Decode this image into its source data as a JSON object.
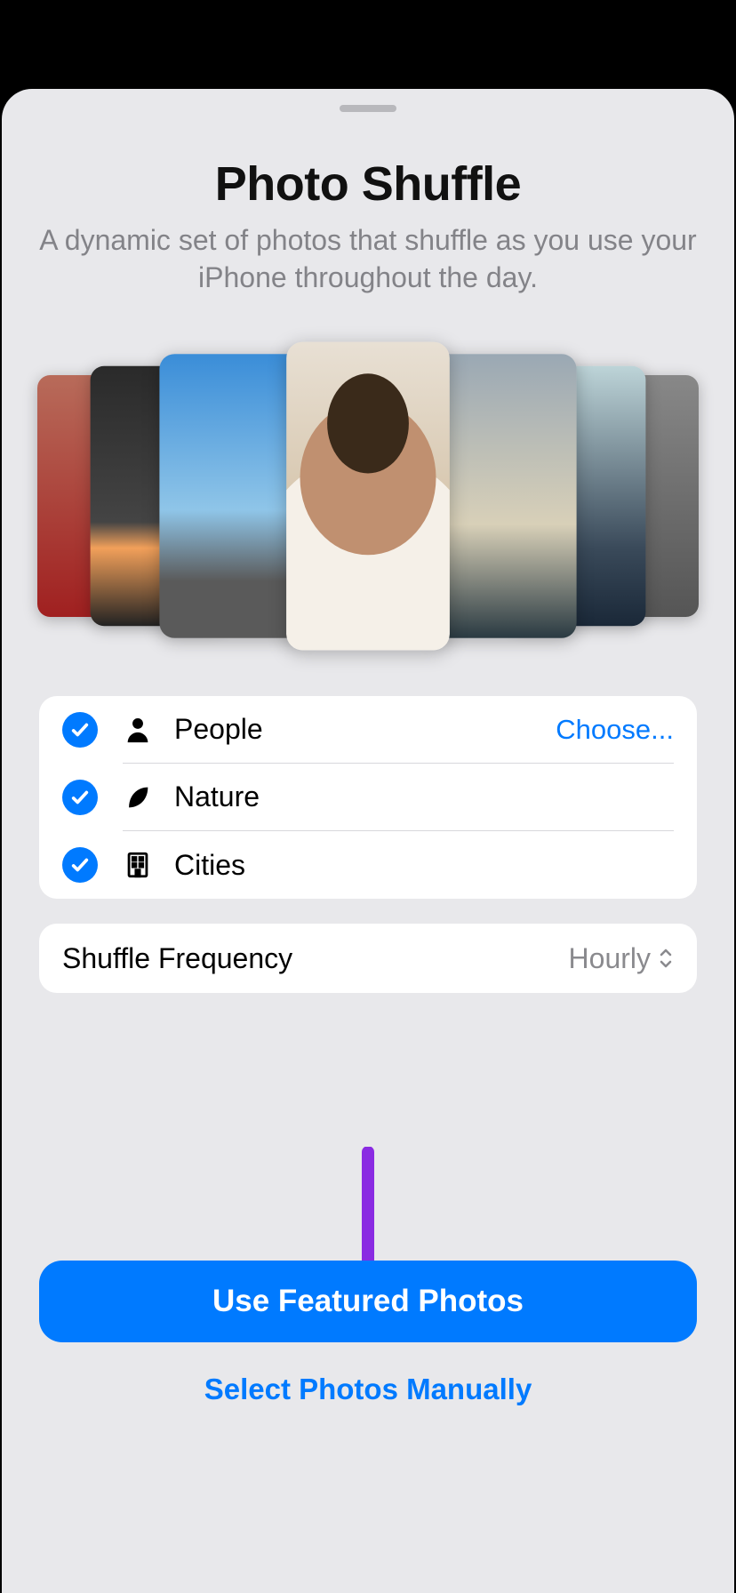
{
  "title": "Photo Shuffle",
  "subtitle": "A dynamic set of photos that shuffle as you use your iPhone throughout the day.",
  "categories": [
    {
      "label": "People",
      "checked": true,
      "action": "Choose..."
    },
    {
      "label": "Nature",
      "checked": true,
      "action": ""
    },
    {
      "label": "Cities",
      "checked": true,
      "action": ""
    }
  ],
  "frequency": {
    "label": "Shuffle Frequency",
    "value": "Hourly"
  },
  "primary_button": "Use Featured Photos",
  "secondary_button": "Select Photos Manually"
}
